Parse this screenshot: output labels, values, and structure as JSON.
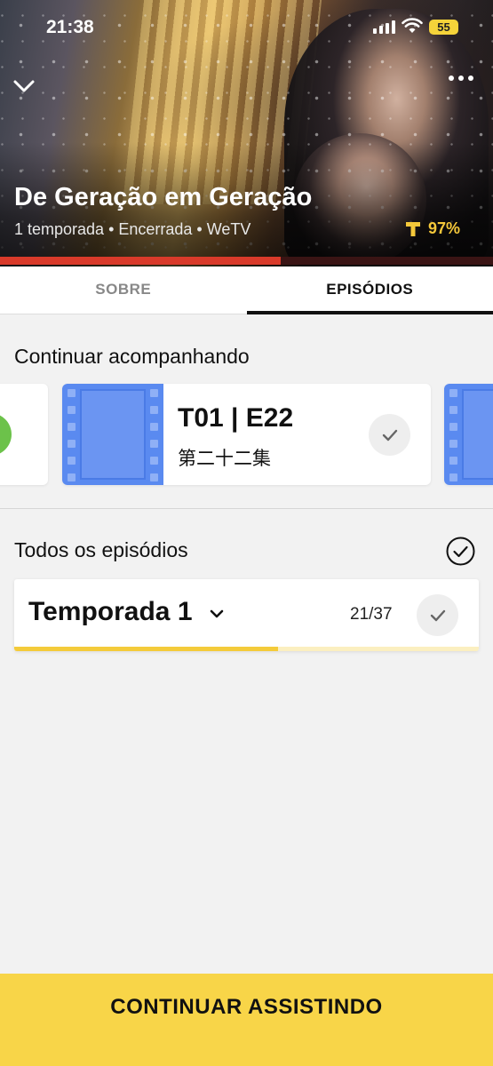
{
  "status_bar": {
    "time": "21:38",
    "battery": "55"
  },
  "hero": {
    "title": "De Geração em Geração",
    "meta": "1 temporada • Encerrada • WeTV",
    "rating": "97%",
    "progress": 0.57
  },
  "tabs": [
    {
      "label": "SOBRE",
      "active": false
    },
    {
      "label": "EPISÓDIOS",
      "active": true
    }
  ],
  "continue_section": {
    "title": "Continuar acompanhando",
    "current_episode": {
      "code": "T01 | E22",
      "name": "第二十二集"
    }
  },
  "all_episodes": {
    "title": "Todos os episódios",
    "season": {
      "label": "Temporada 1",
      "count": "21/37",
      "progress": 0.568
    }
  },
  "cta": {
    "label": "CONTINUAR ASSISTINDO"
  },
  "colors": {
    "accent_yellow": "#f8d548",
    "watched_green": "#6cc24a",
    "episode_blue": "#5a8af0",
    "progress_red": "#d93a2a"
  },
  "icons": [
    "chevron-down-icon",
    "more-icon",
    "rating-t-icon",
    "check-icon",
    "film-icon",
    "check-circle-icon"
  ]
}
